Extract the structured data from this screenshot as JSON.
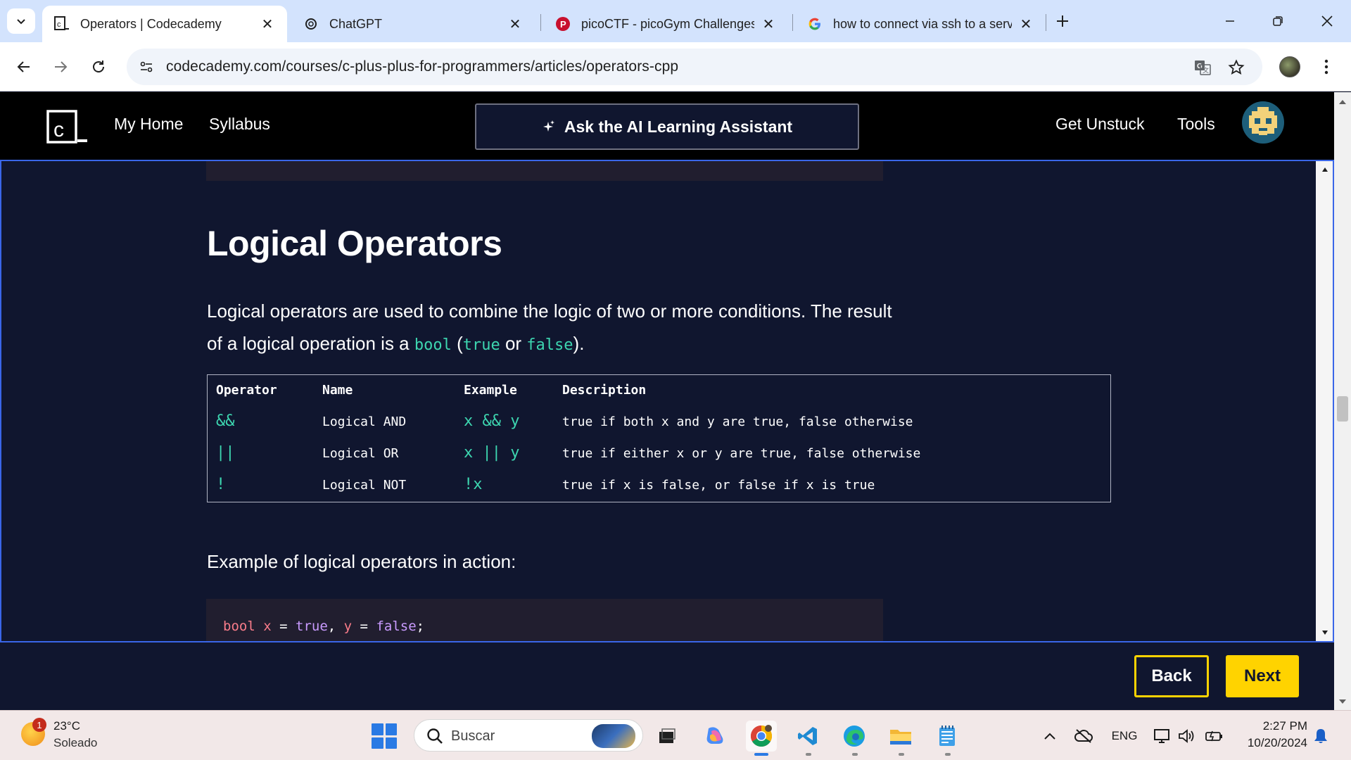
{
  "browser": {
    "tabs": [
      {
        "title": "Operators | Codecademy",
        "active": true,
        "favicon": "codecademy-icon"
      },
      {
        "title": "ChatGPT",
        "active": false,
        "favicon": "chatgpt-icon"
      },
      {
        "title": "picoCTF - picoGym Challenges",
        "active": false,
        "favicon": "picoctf-icon"
      },
      {
        "title": "how to connect via ssh to a serv",
        "active": false,
        "favicon": "google-icon"
      }
    ],
    "url": "codecademy.com/courses/c-plus-plus-for-programmers/articles/operators-cpp"
  },
  "header": {
    "nav": [
      "My Home",
      "Syllabus"
    ],
    "ai_button": "Ask the AI Learning Assistant",
    "right_nav": [
      "Get Unstuck",
      "Tools"
    ]
  },
  "article": {
    "heading": "Logical Operators",
    "para": {
      "t1": "Logical operators are used to combine the logic of two or more conditions. The result of a logical operation is a ",
      "c1": "bool",
      "t2": " (",
      "c2": "true",
      "t3": " or ",
      "c3": "false",
      "t4": ")."
    },
    "table": {
      "headers": [
        "Operator",
        "Name",
        "Example",
        "Description"
      ],
      "rows": [
        {
          "operator": "&&",
          "name": "Logical AND",
          "example": "x && y",
          "description": "true if both x and y are true, false otherwise"
        },
        {
          "operator": "||",
          "name": "Logical OR",
          "example": "x || y",
          "description": "true if either x or y are true, false otherwise"
        },
        {
          "operator": "!",
          "name": "Logical NOT",
          "example": "!x",
          "description": "true if x is false, or false if x is true"
        }
      ]
    },
    "example_label": "Example of logical operators in action:",
    "code": {
      "kw": "bool",
      "v1": "x",
      "eq": " = ",
      "l1": "true",
      "comma": ", ",
      "v2": "y",
      "l2": "false",
      "end": ";"
    }
  },
  "footer": {
    "back": "Back",
    "next": "Next"
  },
  "taskbar": {
    "weather_badge": "1",
    "temperature": "23°C",
    "condition": "Soleado",
    "search_placeholder": "Buscar",
    "language": "ENG",
    "time": "2:27 PM",
    "date": "10/20/2024"
  },
  "colors": {
    "page_bg": "#10162f",
    "accent_yellow": "#ffd300",
    "code_green": "#3dd6b0",
    "focus_border": "#3a66e8"
  }
}
